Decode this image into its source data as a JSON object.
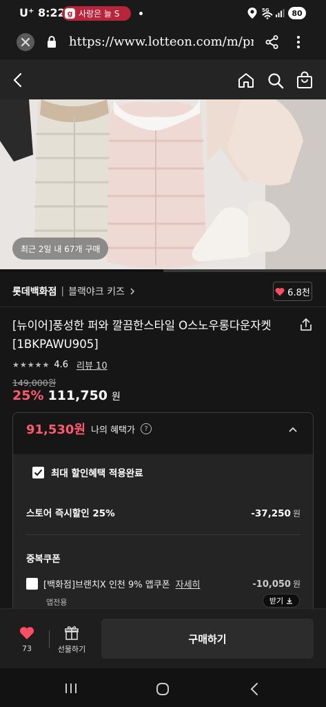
{
  "status_bar": {
    "carrier": "U⁺ 8:22",
    "notification_text": "사랑은 늘 S",
    "battery": "80"
  },
  "browser": {
    "url": "https://www.lotteon.com/m/proc"
  },
  "product": {
    "recent_purchase": "최근 2일 내 67개 구매",
    "image_progress": 0.5,
    "brand_store": "롯데백화점",
    "brand_name": "블랙야크 키즈",
    "like_badge": "6.8천",
    "title": "[뉴이어]풍성한 퍼와 깔끔한스타일 O스노우롱다운자켓 [1BKPAWU905]",
    "rating": "4.6",
    "review_link": "리뷰 10",
    "original_price": "149,000원",
    "discount_percent": "25%",
    "sale_price": "111,750",
    "currency": "원"
  },
  "benefits": {
    "benefit_price": "91,530원",
    "benefit_label": "나의 혜택가",
    "max_discount_label": "최대 할인혜택 적용완료",
    "store_discount_label": "스토어 즉시할인 25%",
    "store_discount_value": "-37,250",
    "currency": "원",
    "coupon_section_title": "중복쿠폰",
    "coupon_name": "[백화점]브랜치X 인천 9% 앱쿠폰",
    "coupon_detail": "자세히",
    "coupon_value": "-10,050",
    "coupon_note": "앱전용",
    "receive_label": "받기"
  },
  "bottom_bar": {
    "like_count": "73",
    "gift_label": "선물하기",
    "buy_label": "구매하기"
  },
  "colors": {
    "accent": "#ff5a6e",
    "background": "#161616",
    "notification": "#b8243a"
  }
}
